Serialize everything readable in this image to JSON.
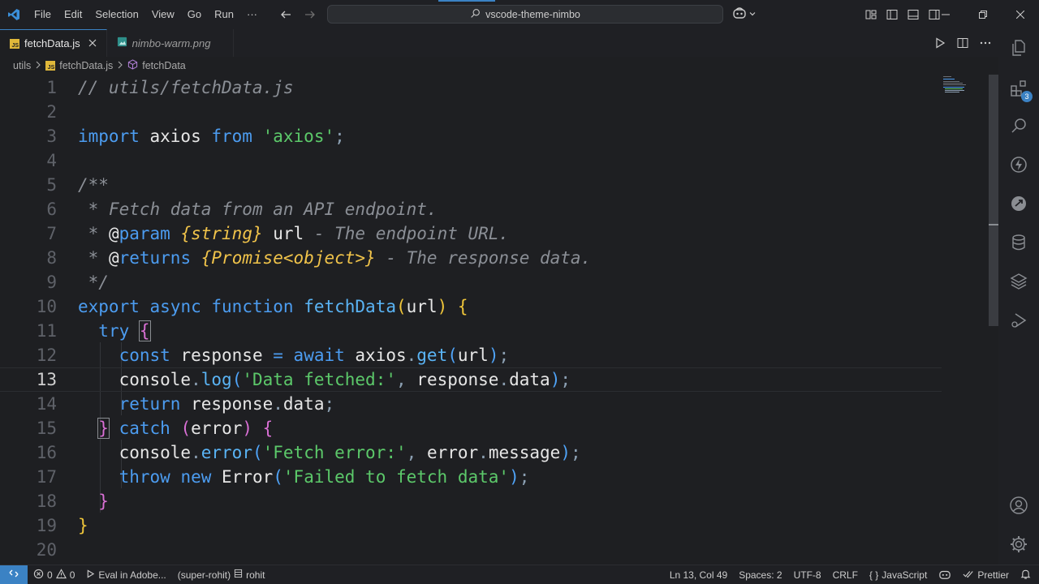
{
  "titlebar": {
    "menu": [
      "File",
      "Edit",
      "Selection",
      "View",
      "Go",
      "Run",
      "···"
    ],
    "search_text": "vscode-theme-nimbo"
  },
  "tabs": [
    {
      "label": "fetchData.js",
      "active": true,
      "icon": "js-file-icon"
    },
    {
      "label": "nimbo-warm.png",
      "active": false,
      "icon": "image-file-icon"
    }
  ],
  "breadcrumb": {
    "folder": "utils",
    "file": "fetchData.js",
    "symbol": "fetchData"
  },
  "editor": {
    "current_line": 13,
    "line_numbers": [
      "1",
      "2",
      "3",
      "4",
      "5",
      "6",
      "7",
      "8",
      "9",
      "10",
      "11",
      "12",
      "13",
      "14",
      "15",
      "16",
      "17",
      "18",
      "19",
      "20"
    ],
    "code": {
      "l1_comment": "// utils/fetchData.js",
      "l3_import": "import",
      "l3_axios": " axios ",
      "l3_from": "from",
      "l3_str": "'axios'",
      "l3_semi": ";",
      "l5_open": "/**",
      "l6_star": " * ",
      "l6_text": "Fetch data from an API endpoint.",
      "l7_star": " * ",
      "l7_at": "@",
      "l7_tag": "param",
      "l7_type": "{string}",
      "l7_name": " url",
      "l7_desc": " - The endpoint URL.",
      "l8_star": " * ",
      "l8_at": "@",
      "l8_tag": "returns",
      "l8_type": "{Promise<object>}",
      "l8_desc": " - The response data.",
      "l9_close": " */",
      "l10_export": "export",
      "l10_async": "async",
      "l10_function": "function",
      "l10_name": "fetchData",
      "l10_open": "(",
      "l10_param": "url",
      "l10_close": ")",
      "l10_brace": "{",
      "l11_try": "try",
      "l11_brace": "{",
      "l12_const": "const",
      "l12_var": " response ",
      "l12_eq": "=",
      "l12_await": "await",
      "l12_obj": " axios",
      "l12_dot": ".",
      "l12_get": "get",
      "l12_open": "(",
      "l12_arg": "url",
      "l12_close": ")",
      "l12_semi": ";",
      "l13_console": "console",
      "l13_dot": ".",
      "l13_log": "log",
      "l13_open": "(",
      "l13_str": "'Data fetched:'",
      "l13_comma": ",",
      "l13_resp": " response",
      "l13_dot2": ".",
      "l13_data": "data",
      "l13_close": ")",
      "l13_semi": ";",
      "l14_return": "return",
      "l14_resp": " response",
      "l14_dot": ".",
      "l14_data": "data",
      "l14_semi": ";",
      "l15_brace": "}",
      "l15_catch": "catch",
      "l15_open": "(",
      "l15_err": "error",
      "l15_close": ")",
      "l15_brace2": "{",
      "l16_console": "console",
      "l16_dot": ".",
      "l16_error": "error",
      "l16_open": "(",
      "l16_str": "'Fetch error:'",
      "l16_comma": ",",
      "l16_err": " error",
      "l16_dot2": ".",
      "l16_msg": "message",
      "l16_close": ")",
      "l16_semi": ";",
      "l17_throw": "throw",
      "l17_new": "new",
      "l17_cls": " Error",
      "l17_open": "(",
      "l17_str": "'Failed to fetch data'",
      "l17_close": ")",
      "l17_semi": ";",
      "l18_brace": "}",
      "l19_brace": "}"
    }
  },
  "activitybar": {
    "extensions_badge": "3"
  },
  "statusbar": {
    "errors": "0",
    "warnings": "0",
    "eval": "Eval in Adobe...",
    "profile": "(super-rohit)",
    "user": "rohit",
    "position": "Ln 13, Col 49",
    "spaces": "Spaces: 2",
    "encoding": "UTF-8",
    "eol": "CRLF",
    "language_braces": "{ }",
    "language": "JavaScript",
    "prettier": "Prettier"
  },
  "colors": {
    "accent": "#3b82c4",
    "keyword": "#4c9cf0",
    "string": "#5cc96a",
    "type": "#f0c34a",
    "comment": "#8b8f96"
  }
}
